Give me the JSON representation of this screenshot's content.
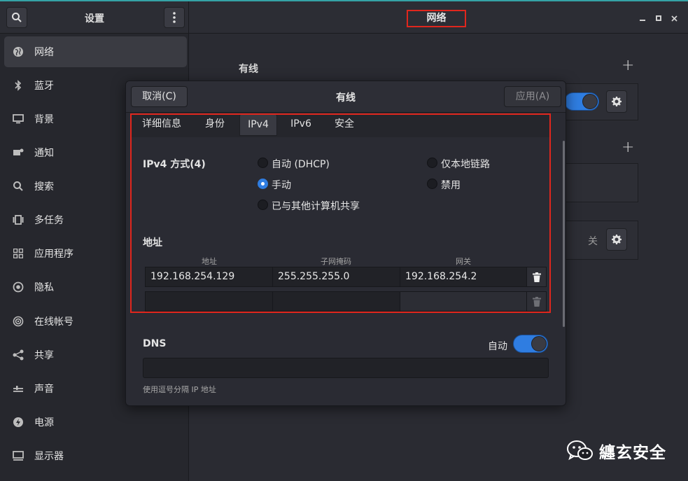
{
  "header": {
    "left_title": "设置",
    "right_title": "网络"
  },
  "sidebar": {
    "items": [
      {
        "label": "网络",
        "icon": "network-globe-icon"
      },
      {
        "label": "蓝牙",
        "icon": "bluetooth-icon"
      },
      {
        "label": "背景",
        "icon": "monitor-icon"
      },
      {
        "label": "通知",
        "icon": "notification-icon"
      },
      {
        "label": "搜索",
        "icon": "search-icon"
      },
      {
        "label": "多任务",
        "icon": "multitask-icon"
      },
      {
        "label": "应用程序",
        "icon": "apps-grid-icon"
      },
      {
        "label": "隐私",
        "icon": "privacy-icon"
      },
      {
        "label": "在线帐号",
        "icon": "online-account-icon"
      },
      {
        "label": "共享",
        "icon": "share-icon"
      },
      {
        "label": "声音",
        "icon": "sound-icon"
      },
      {
        "label": "电源",
        "icon": "power-icon"
      },
      {
        "label": "显示器",
        "icon": "display-icon"
      }
    ]
  },
  "background": {
    "wired_title": "有线",
    "vpn_off_label": "关"
  },
  "dialog": {
    "cancel_label": "取消(C)",
    "title": "有线",
    "apply_label": "应用(A)",
    "tabs": [
      "详细信息",
      "身份",
      "IPv4",
      "IPv6",
      "安全"
    ],
    "active_tab": "IPv4",
    "method_label": "IPv4 方式(4)",
    "methods": {
      "auto": "自动 (DHCP)",
      "local": "仅本地链路",
      "manual": "手动",
      "disabled": "禁用",
      "shared": "已与其他计算机共享"
    },
    "selected_method": "手动",
    "address_section": "地址",
    "columns": {
      "address": "地址",
      "netmask": "子网掩码",
      "gateway": "网关"
    },
    "rows": [
      {
        "address": "192.168.254.129",
        "netmask": "255.255.255.0",
        "gateway": "192.168.254.2"
      },
      {
        "address": "",
        "netmask": "",
        "gateway": ""
      }
    ],
    "dns_label": "DNS",
    "dns_auto_label": "自动",
    "dns_auto": true,
    "dns_hint": "使用逗号分隔 IP 地址"
  },
  "watermark": {
    "text": "纏玄安全"
  },
  "colors": {
    "accent": "#2f7de1",
    "highlight": "#e0261d"
  }
}
